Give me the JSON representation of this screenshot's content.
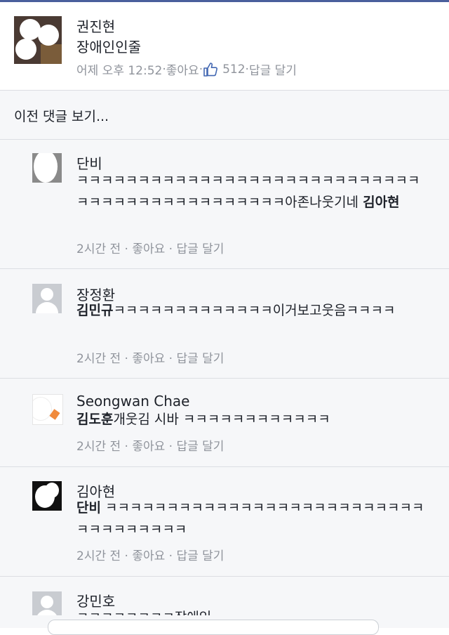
{
  "post": {
    "author": "권진현",
    "text": "장애인인줄",
    "time": "어제 오후 12:52",
    "sep": " · ",
    "like": "좋아요",
    "likes_count": "512",
    "reply": "답글 달기"
  },
  "comments_header": {
    "prev_link": "이전 댓글 보기..."
  },
  "comments": [
    {
      "name": "단비",
      "body": "ㅋㅋㅋㅋㅋㅋㅋㅋㅋㅋㅋㅋㅋㅋㅋㅋㅋㅋㅋㅋㅋㅋㅋㅋㅋㅋㅋㅋㅋㅋㅋㅋㅋㅋㅋㅋㅋㅋㅋㅋㅋㅋㅋㅋㅋ아존나웃기네 ",
      "tag": "김아현",
      "meta": "2시간 전 · 좋아요 · 답글 달기"
    },
    {
      "name": "장정환",
      "tag": "김민규",
      "body": "ㅋㅋㅋㅋㅋㅋㅋㅋㅋㅋㅋㅋㅋ이거보고웃음ㅋㅋㅋㅋ",
      "meta": "2시간 전 · 좋아요 · 답글 달기"
    },
    {
      "name": "Seongwan Chae",
      "tag": "김도훈",
      "body": "개웃김 시바 ㅋㅋㅋㅋㅋㅋㅋㅋㅋㅋㅋㅋ",
      "meta": "2시간 전 · 좋아요 · 답글 달기"
    },
    {
      "name": "김아현",
      "tag": "단비",
      "body": " ㅋㅋㅋㅋㅋㅋㅋㅋㅋㅋㅋㅋㅋㅋㅋㅋㅋㅋㅋㅋㅋㅋㅋㅋㅋㅋㅋㅋㅋㅋㅋㅋㅋㅋㅋ",
      "meta": "2시간 전 · 좋아요 · 답글 달기"
    },
    {
      "name": "강민호",
      "body": "ㅋㅋㅋㅋㅋㅋㅋㅋ장애인"
    }
  ],
  "colors": {
    "text": "#1d2129",
    "meta": "#90949c",
    "background": "#f6f7f9",
    "like_icon": "#4267b2"
  },
  "icons": {
    "like": "thumbs-up-icon"
  }
}
